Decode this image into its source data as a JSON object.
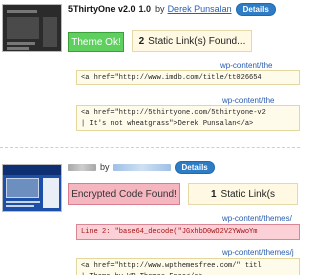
{
  "themes": [
    {
      "name": "5ThirtyOne v2.0",
      "version": "1.0",
      "by": "by",
      "author": "Derek Punsalan",
      "details_label": "Details",
      "status": "Theme Ok!",
      "static_count": "2",
      "static_label": "Static Link(s) Found...",
      "files": [
        {
          "path": "wp-content/the",
          "code": "<a href=\"http://www.imdb.com/title/tt026654"
        },
        {
          "path": "wp-content/the",
          "code": "<a href=\"http://5thirtyone.com/5thirtyone-v2\n| It's not wheatgrass\">Derek Punsalan</a>"
        }
      ]
    },
    {
      "name": "",
      "version": "",
      "by": "by",
      "author": "",
      "details_label": "Details",
      "status": "Encrypted Code Found!",
      "static_count": "1",
      "static_label": "Static Link(s",
      "files": [
        {
          "path": "wp-content/themes/",
          "code": "Line 2: \"base64_decode(\"JGxhbD0wO2V2YWwoYm"
        },
        {
          "path": "wp-content/themes/j",
          "code": "<a href=\"http://www.wpthemesfree.com/\" titl\n| Theme by WP Themes Free</a>"
        }
      ]
    }
  ]
}
